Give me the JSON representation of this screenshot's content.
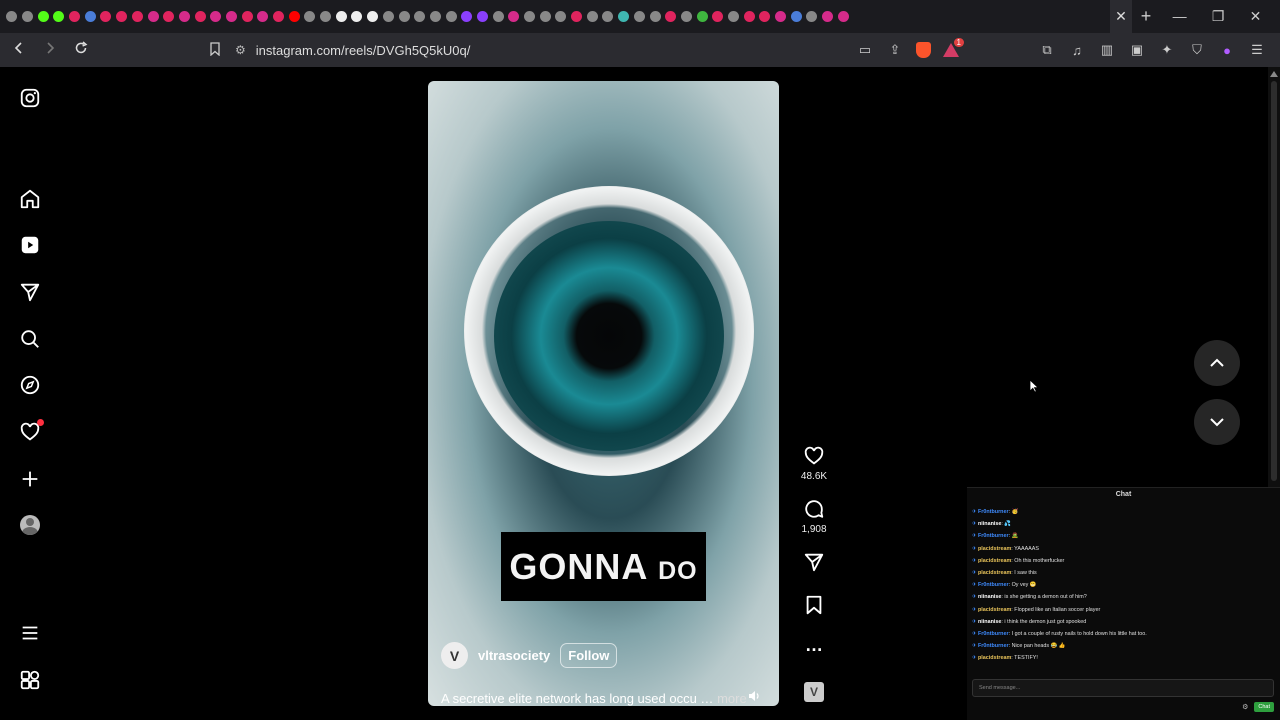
{
  "browser": {
    "tab_favicon_colors": [
      "#888888",
      "#888888",
      "#53fc18",
      "#53fc18",
      "#e0245e",
      "#4a7dd8",
      "#e0245e",
      "#e0245e",
      "#e0245e",
      "#d52b8a",
      "#e0245e",
      "#d52b8a",
      "#e0245e",
      "#d52b8a",
      "#d52b8a",
      "#e0245e",
      "#d52b8a",
      "#e0245e",
      "#ff0000",
      "#888888",
      "#888888",
      "#eeeeee",
      "#eeeeee",
      "#eeeeee",
      "#888888",
      "#888888",
      "#888888",
      "#888888",
      "#888888",
      "#8a3ffc",
      "#8a3ffc",
      "#888888",
      "#d52b8a",
      "#888888",
      "#888888",
      "#888888",
      "#e0245e",
      "#888888",
      "#888888",
      "#3fb6b0",
      "#888888",
      "#888888",
      "#e0245e",
      "#888888",
      "#3fb63f",
      "#e0245e",
      "#888888",
      "#e0245e",
      "#e0245e",
      "#d52b8a",
      "#4a7dd8",
      "#888888",
      "#d52b8a",
      "#d52b8a"
    ],
    "active_tab_close": "✕",
    "new_tab": "+",
    "window_controls": [
      "—",
      "❐",
      "✕"
    ],
    "url": "instagram.com/reels/DVGh5Q5kU0q/",
    "brave_badge_count": "1",
    "accent": "#fb542b"
  },
  "sidebar": {
    "items": [
      "instagram-logo",
      "home",
      "reels",
      "messages",
      "search",
      "explore",
      "notifications",
      "create",
      "profile",
      "more",
      "also-from-meta"
    ]
  },
  "reel": {
    "caption_overlay_big": "GONNA",
    "caption_overlay_small": "DO",
    "author": "vltrasociety",
    "author_initial": "V",
    "follow_label": "Follow",
    "description": "A secretive elite network has long used occu …",
    "more_label": "more"
  },
  "actions": {
    "likes": "48.6K",
    "comments": "1,908",
    "audio_initial": "V",
    "more_glyph": "…"
  },
  "chat": {
    "title": "Chat",
    "lines": [
      {
        "user": "Fr0ntburner",
        "color": "u-blue",
        "msg": ": 🥳"
      },
      {
        "user": "niinanise",
        "color": "u-white",
        "msg": ": 💦"
      },
      {
        "user": "Fr0ntburner",
        "color": "u-blue",
        "msg": ": 🧟"
      },
      {
        "user": "placidstream",
        "color": "u-yellow",
        "msg": ": YAAAAAS"
      },
      {
        "user": "placidstream",
        "color": "u-yellow",
        "msg": ": Oh this motherfucker"
      },
      {
        "user": "placidstream",
        "color": "u-yellow",
        "msg": ": I saw this"
      },
      {
        "user": "Fr0ntburner",
        "color": "u-blue",
        "msg": ": Oy vey 😬"
      },
      {
        "user": "niinanise",
        "color": "u-white",
        "msg": ": is she getting a demon out of him?"
      },
      {
        "user": "placidstream",
        "color": "u-yellow",
        "msg": ": Flopped like an Italian soccer player"
      },
      {
        "user": "niinanise",
        "color": "u-white",
        "msg": ": i think the demon just got spooked"
      },
      {
        "user": "Fr0ntburner",
        "color": "u-blue",
        "msg": ": I got a couple of rusty nails to hold down his little hat too."
      },
      {
        "user": "Fr0ntburner",
        "color": "u-blue",
        "msg": ": Nice pan heads 😂 👍"
      },
      {
        "user": "placidstream",
        "color": "u-yellow",
        "msg": ": TESTIFY!"
      }
    ],
    "input_placeholder": "Send message...",
    "send_label": "Chat"
  }
}
